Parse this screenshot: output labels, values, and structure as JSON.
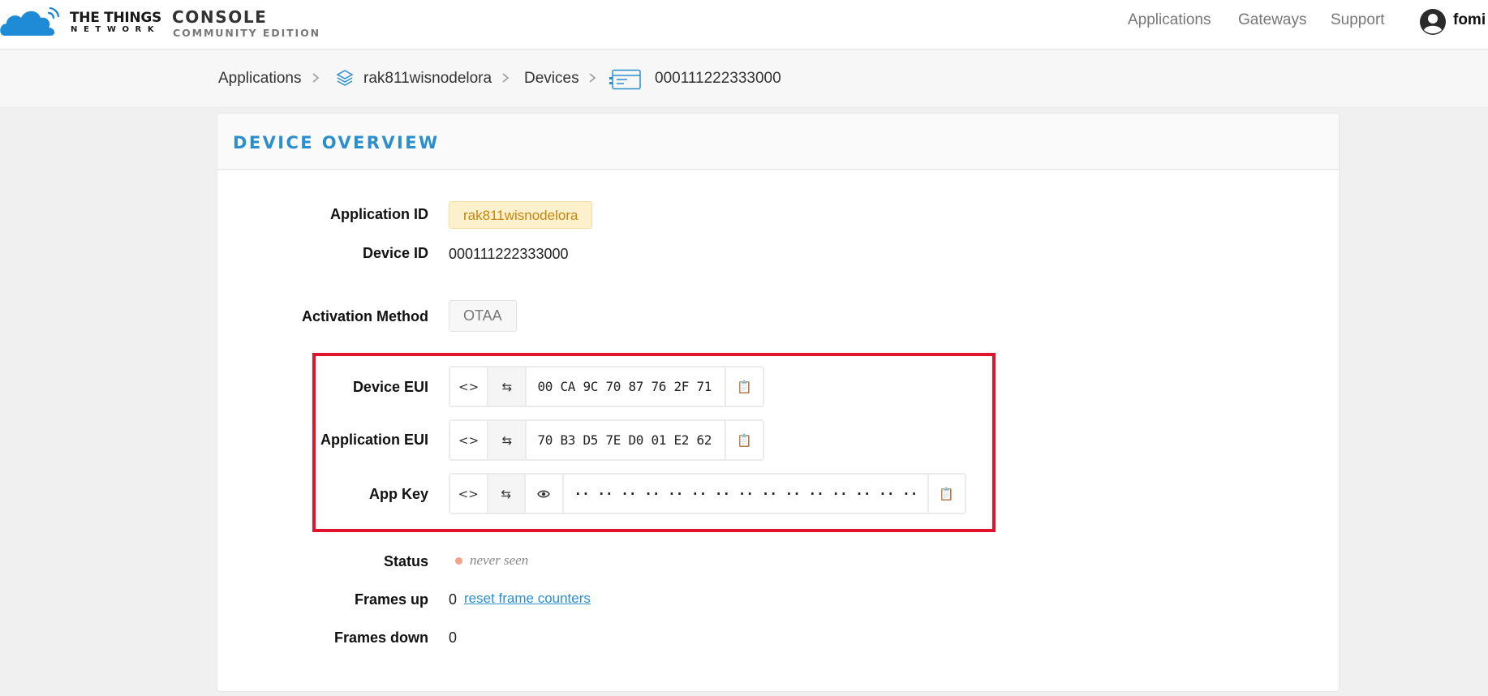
{
  "brand": {
    "line1": "THE THINGS",
    "line2": "NETWORK",
    "console": "CONSOLE",
    "edition": "COMMUNITY EDITION",
    "logo_icon": "ttn-cloud-icon",
    "brand_color": "#2c8fcd"
  },
  "nav": {
    "applications": "Applications",
    "gateways": "Gateways",
    "support": "Support",
    "user_icon": "user-avatar-icon",
    "user_name": "fomi"
  },
  "breadcrumb": {
    "applications": "Applications",
    "application_icon": "layers-icon",
    "application": "rak811wisnodelora",
    "devices": "Devices",
    "device_icon": "device-icon",
    "device": "000111222333000"
  },
  "overview": {
    "title": "DEVICE OVERVIEW",
    "application_id_label": "Application ID",
    "application_id": "rak811wisnodelora",
    "device_id_label": "Device ID",
    "device_id": "000111222333000",
    "activation_label": "Activation Method",
    "activation": "OTAA",
    "device_eui_label": "Device EUI",
    "device_eui": "00 CA 9C 70 87 76 2F 71",
    "app_eui_label": "Application EUI",
    "app_eui": "70 B3 D5 7E D0 01 E2 62",
    "app_key_label": "App Key",
    "app_key": "·· ·· ·· ·· ·· ·· ·· ·· ·· ·· ·· ·· ·· ·· ·· ··",
    "code_glyph": "<>",
    "status_label": "Status",
    "status": "never seen",
    "status_color": "#f5a28a",
    "frames_up_label": "Frames up",
    "frames_up": "0",
    "reset_link": "reset frame counters",
    "frames_down_label": "Frames down",
    "frames_down": "0",
    "highlight_color": "#e0142a"
  }
}
